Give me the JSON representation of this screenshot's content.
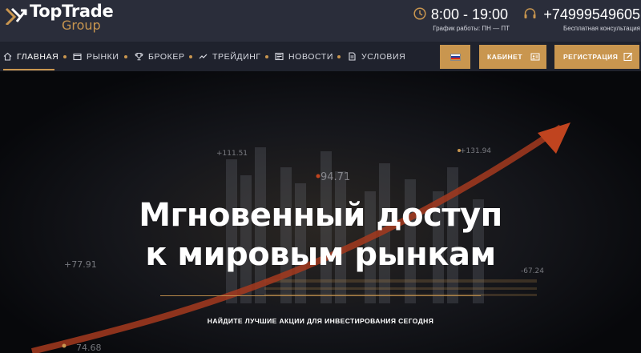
{
  "header": {
    "logo": {
      "name": "TopTrade",
      "sub": "Group"
    },
    "hours": {
      "time": "8:00 - 19:00",
      "caption": "График работы: ПН — ПТ",
      "icon": "clock-icon"
    },
    "phone": {
      "number": "+74999549605",
      "caption": "Бесплатная консультация",
      "icon": "headset-icon"
    }
  },
  "nav": {
    "items": [
      {
        "label": "ГЛАВНАЯ",
        "icon": "home-icon"
      },
      {
        "label": "РЫНКИ",
        "icon": "folder-icon"
      },
      {
        "label": "БРОКЕР",
        "icon": "trophy-icon"
      },
      {
        "label": "ТРЕЙДИНГ",
        "icon": "chart-line-icon"
      },
      {
        "label": "НОВОСТИ",
        "icon": "newspaper-icon"
      },
      {
        "label": "УСЛОВИЯ",
        "icon": "document-icon"
      }
    ],
    "lang_flag": "russia-flag-icon",
    "cabinet_label": "КАБИНЕТ",
    "register_label": "РЕГИСТРАЦИЯ"
  },
  "hero": {
    "title_line1": "Мгновенный доступ",
    "title_line2": "к мировым рынкам",
    "subtitle": "НАЙДИТЕ ЛУЧШИЕ АКЦИИ ДЛЯ ИНВЕСТИРОВАНИЯ СЕГОДНЯ",
    "bg_numbers": [
      "+111.51",
      "+131.94",
      "94.71",
      "+77.91",
      "-67.24",
      "74.68"
    ]
  },
  "colors": {
    "accent": "#c9964f",
    "header_bg": "#2a2d3a",
    "nav_bg": "#1f222d",
    "arrow": "#a43a1e"
  }
}
